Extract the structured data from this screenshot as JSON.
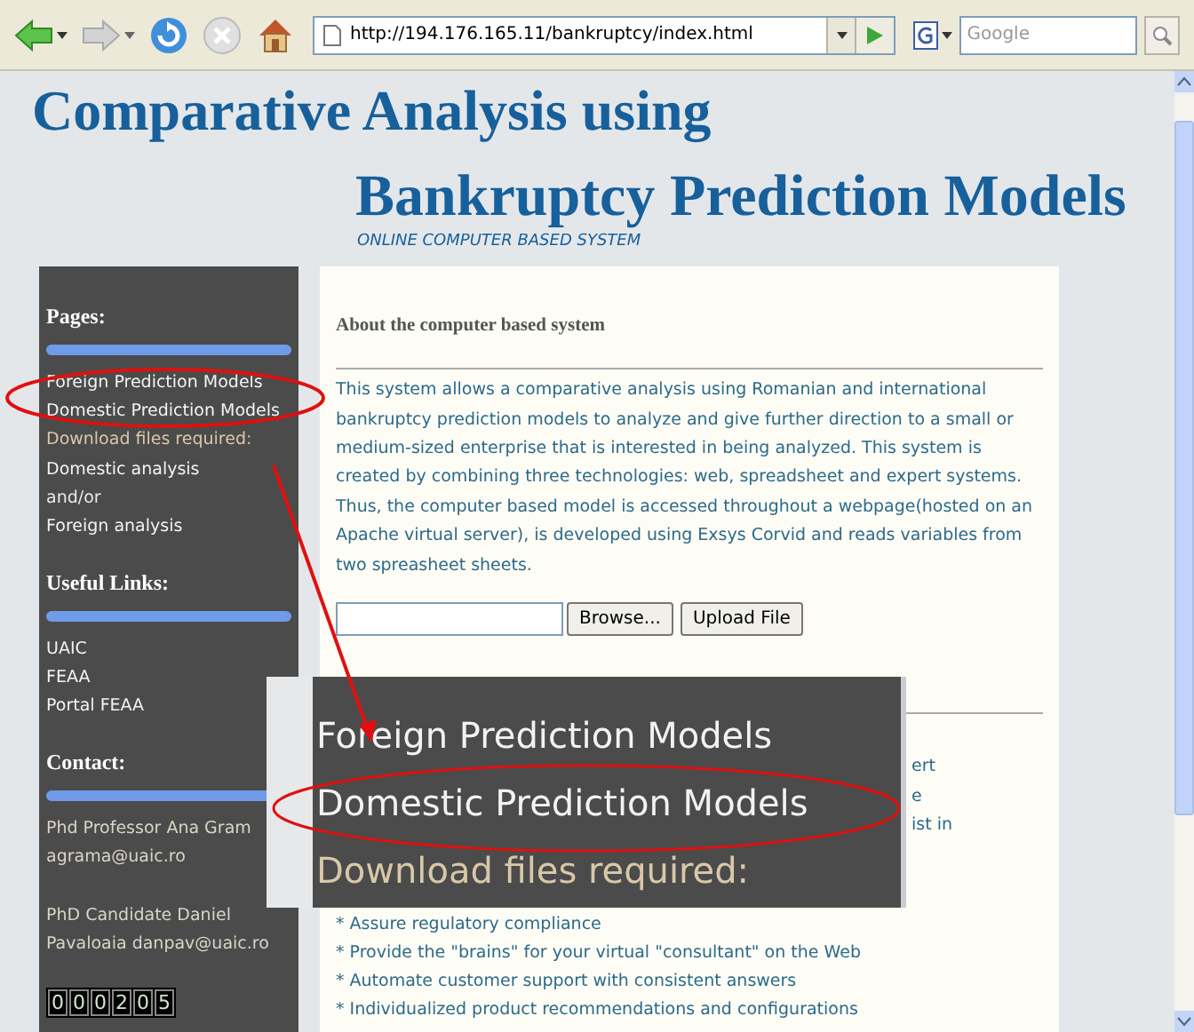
{
  "browser": {
    "url": "http://194.176.165.11/bankruptcy/index.html",
    "search": {
      "placeholder": "Google"
    }
  },
  "header": {
    "title": "Comparative Analysis using",
    "subtitle": "Bankruptcy Prediction Models",
    "tagline": "ONLINE COMPUTER BASED SYSTEM"
  },
  "sidebar": {
    "sections": [
      {
        "heading": "Pages:",
        "items": [
          {
            "text": "Foreign Prediction Models",
            "kind": "link"
          },
          {
            "text": "Domestic Prediction Models",
            "kind": "link"
          },
          {
            "text": "Download files required:",
            "kind": "note"
          },
          {
            "text": "Domestic analysis",
            "kind": "link"
          },
          {
            "text": "and/or",
            "kind": "text"
          },
          {
            "text": "Foreign analysis",
            "kind": "link"
          }
        ]
      },
      {
        "heading": "Useful Links:",
        "items": [
          {
            "text": "UAIC",
            "kind": "link"
          },
          {
            "text": "FEAA",
            "kind": "link"
          },
          {
            "text": "Portal FEAA",
            "kind": "link"
          }
        ]
      }
    ],
    "contact_heading": "Contact:",
    "contacts": [
      [
        "Phd Professor Ana Gram",
        "agrama@uaic.ro"
      ],
      [
        "PhD Candidate Daniel",
        "Pavaloaia danpav@uaic.ro"
      ]
    ],
    "counter": [
      "0",
      "0",
      "0",
      "2",
      "0",
      "5"
    ]
  },
  "content": {
    "heading": "About the computer based system",
    "paragraph": "This system allows a comparative analysis using Romanian and international bankruptcy prediction models to analyze and give further direction to a small or medium-sized enterprise that is interested in being analyzed. This system is created by combining three technologies: web, spreadsheet and expert systems. Thus, the computer based model is accessed throughout a webpage(hosted on an Apache virtual server), is developed using Exsys Corvid and reads variables from two spreasheet sheets.",
    "upload": {
      "browse": "Browse...",
      "submit": "Upload File"
    },
    "covered_fragments": [
      "ert",
      "e",
      "ist in"
    ],
    "features": [
      "* Assure regulatory compliance",
      "* Provide the \"brains\" for your virtual \"consultant\" on the Web",
      "* Automate customer support with consistent answers",
      "* Individualized product recommendations and configurations"
    ]
  },
  "inset": {
    "items": [
      {
        "text": "Foreign Prediction Models",
        "kind": "link"
      },
      {
        "text": "Domestic Prediction Models",
        "kind": "link"
      },
      {
        "text": "Download files required:",
        "kind": "note"
      }
    ]
  }
}
